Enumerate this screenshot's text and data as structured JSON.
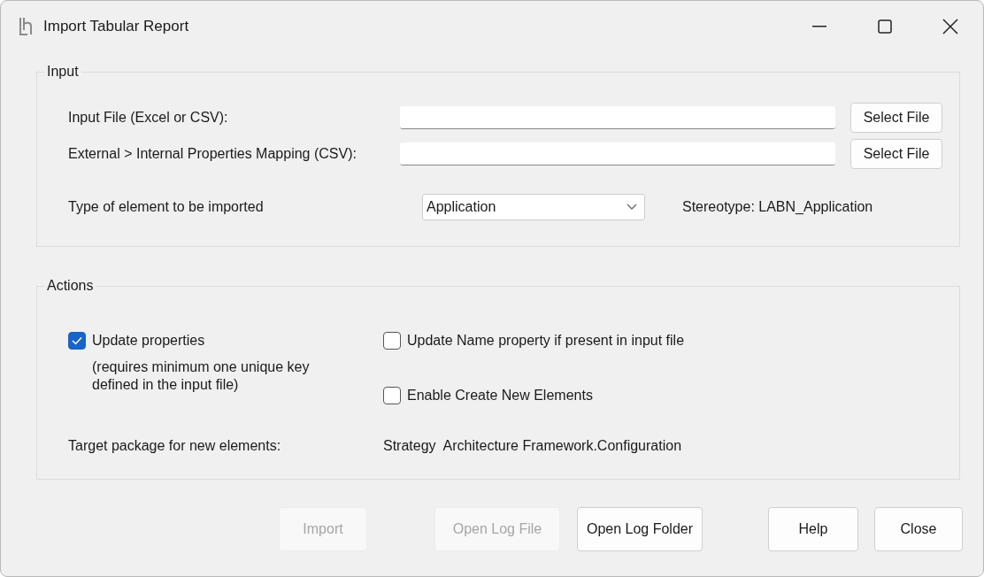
{
  "window": {
    "title": "Import Tabular Report"
  },
  "input_group": {
    "title": "Input",
    "file_rows": [
      {
        "label": "Input File (Excel or CSV):",
        "button": "Select File"
      },
      {
        "label": "External > Internal Properties Mapping (CSV):",
        "button": "Select File"
      }
    ],
    "element_type": {
      "label": "Type of element to be imported",
      "value": "Application"
    },
    "stereotype": "Stereotype: LABN_Application"
  },
  "actions_group": {
    "title": "Actions",
    "update_properties": {
      "label": "Update properties",
      "checked": true,
      "note": "(requires minimum one unique key defined in the input file)"
    },
    "update_name": {
      "label": "Update Name property if present in input file",
      "checked": false
    },
    "enable_create": {
      "label": "Enable Create New Elements",
      "checked": false
    },
    "target_package": {
      "label": "Target package for new elements:",
      "value": "Strategy  Architecture Framework.Configuration"
    }
  },
  "buttons": [
    {
      "label": "Import",
      "disabled": true
    },
    {
      "label": "Open Log File",
      "disabled": true
    },
    {
      "label": "Open Log Folder",
      "disabled": false
    },
    {
      "label": "Help",
      "disabled": false
    },
    {
      "label": "Close",
      "disabled": false
    }
  ]
}
